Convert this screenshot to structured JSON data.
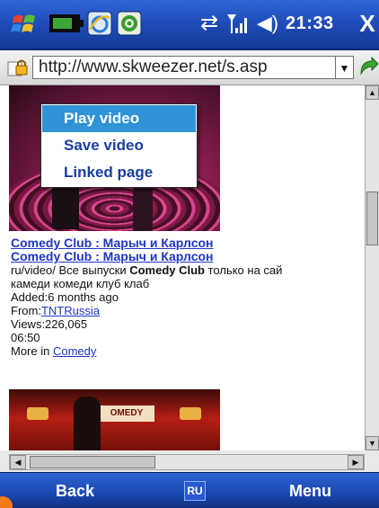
{
  "status_bar": {
    "time": "21:33",
    "close_label": "X",
    "icons": [
      "windows-start-icon",
      "battery-icon",
      "internet-explorer-icon",
      "msn-icon",
      "sync-icon",
      "signal-icon",
      "volume-icon"
    ],
    "battery_level": 0.7
  },
  "address_bar": {
    "url": "http://www.skweezer.net/s.asp",
    "dropdown_glyph": "▼",
    "icons": [
      "page-lock-icon",
      "go-icon"
    ]
  },
  "context_menu": {
    "items": [
      {
        "label": "Play video",
        "selected": true
      },
      {
        "label": "Save video",
        "selected": false
      },
      {
        "label": "Linked page",
        "selected": false
      }
    ]
  },
  "result": {
    "title_link_1": "Comedy Club : Марыч и Карлсон",
    "title_link_2": "Comedy Club : Марыч и Карлсон",
    "desc_prefix": "ru/video/ Все выпуски ",
    "desc_bold": "Comedy Club",
    "desc_suffix": " только на сай",
    "desc_line2": "камеди комеди клуб клаб",
    "added": "Added:6 months ago",
    "from_label": "From:",
    "from_link": "TNTRussia",
    "views": "Views:226,065",
    "duration": "06:50",
    "more_label": "More in ",
    "more_link": "Comedy"
  },
  "thumb2": {
    "sign_text": "OMEDY"
  },
  "scrollbars": {
    "up": "▲",
    "down": "▼",
    "left": "◀",
    "right": "▶"
  },
  "softkeys": {
    "left": "Back",
    "right": "Menu",
    "input_mode": "RU"
  },
  "colors": {
    "titlebar": "#1d49b3",
    "link": "#1f35c9",
    "menu_selected": "#2f93d6",
    "menu_text": "#1a3ea0"
  }
}
